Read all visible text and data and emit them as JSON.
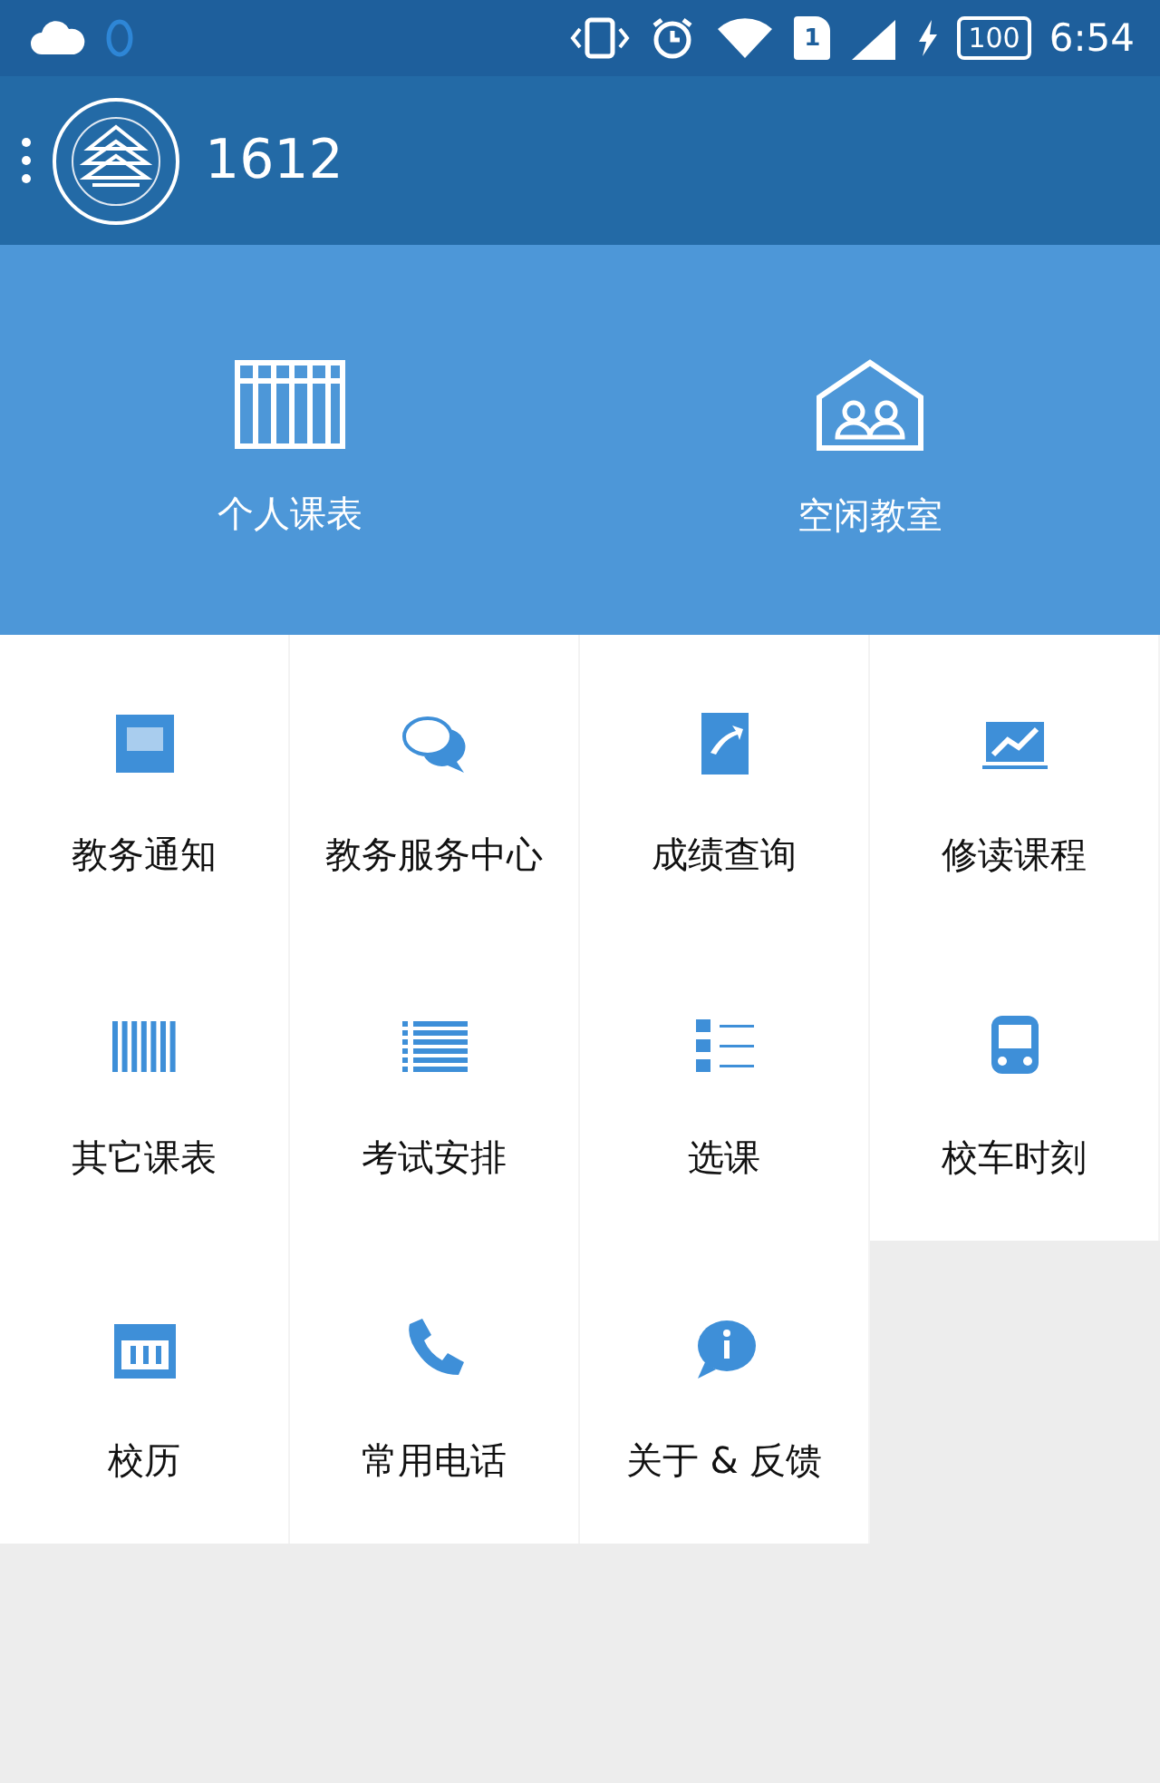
{
  "status_bar": {
    "sim": "1",
    "battery": "100",
    "time": "6:54"
  },
  "app_bar": {
    "title": "1612"
  },
  "hero": [
    {
      "label": "个人课表"
    },
    {
      "label": "空闲教室"
    }
  ],
  "tiles": [
    {
      "label": "教务通知"
    },
    {
      "label": "教务服务中心"
    },
    {
      "label": "成绩查询"
    },
    {
      "label": "修读课程"
    },
    {
      "label": "其它课表"
    },
    {
      "label": "考试安排"
    },
    {
      "label": "选课"
    },
    {
      "label": "校车时刻"
    },
    {
      "label": "校历"
    },
    {
      "label": "常用电话"
    },
    {
      "label": "关于 & 反馈"
    }
  ]
}
